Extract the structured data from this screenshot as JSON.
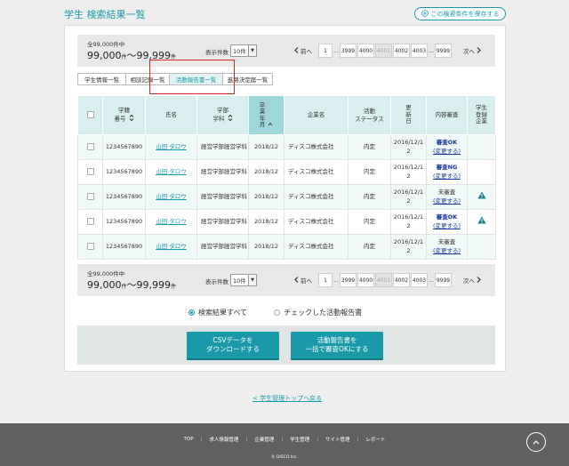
{
  "header": {
    "title": "学生 検索結果一覧",
    "save_button": "この検索条件を保存する"
  },
  "pagination": {
    "total_small": "全99,000件中",
    "range_from": "99,000",
    "range_to": "99,999",
    "unit": "件",
    "per_page_label": "表示件数",
    "per_page_value": "10件",
    "prev_label": "前へ",
    "next_label": "次へ",
    "pages": [
      "1",
      "…",
      "3999",
      "4000",
      "4001",
      "4002",
      "4003",
      "…",
      "9999"
    ],
    "current_page": "4001"
  },
  "tabs": [
    "学生情報一覧",
    "相談記録一覧",
    "活動報告書一覧",
    "進路決定届一覧"
  ],
  "active_tab": "活動報告書一覧",
  "table": {
    "headers": {
      "student_no": "学籍\n番号",
      "name": "氏名",
      "faculty": "学部\n学科",
      "grad_year": "卒\n業\n年\n月",
      "company": "企業名",
      "status": "活動\nステータス",
      "updated": "更\n新\n日",
      "review": "内容審査",
      "registered": "学生\n登録\n企業"
    },
    "rows": [
      {
        "student_no": "1234567890",
        "name": "山田 タロウ",
        "faculty": "経営学部経営学科",
        "grad_year": "2018/12",
        "company": "ディスコ株式会社",
        "status": "内定",
        "updated": "2016/12/12",
        "review": "審査OK",
        "review_bold": true,
        "change": "(変更する)",
        "warning": false
      },
      {
        "student_no": "1234567890",
        "name": "山田 タロウ",
        "faculty": "経営学部経営学科",
        "grad_year": "2018/12",
        "company": "ディスコ株式会社",
        "status": "内定",
        "updated": "2016/12/12",
        "review": "審査NG",
        "review_bold": true,
        "change": "(変更する)",
        "warning": false
      },
      {
        "student_no": "1234567890",
        "name": "山田 タロウ",
        "faculty": "経営学部経営学科",
        "grad_year": "2018/12",
        "company": "ディスコ株式会社",
        "status": "内定",
        "updated": "2016/12/12",
        "review": "未審査",
        "review_bold": false,
        "change": "(変更する)",
        "warning": true
      },
      {
        "student_no": "1234567890",
        "name": "山田 タロウ",
        "faculty": "経営学部経営学科",
        "grad_year": "2018/12",
        "company": "ディスコ株式会社",
        "status": "内定",
        "updated": "2016/12/12",
        "review": "審査OK",
        "review_bold": true,
        "change": "(変更する)",
        "warning": true
      },
      {
        "student_no": "1234567890",
        "name": "山田 タロウ",
        "faculty": "経営学部経営学科",
        "grad_year": "2018/12",
        "company": "ディスコ株式会社",
        "status": "内定",
        "updated": "2016/12/12",
        "review": "未審査",
        "review_bold": false,
        "change": "(変更する)",
        "warning": false
      }
    ]
  },
  "radios": {
    "all": "検索結果すべて",
    "checked": "チェックした活動報告書",
    "selected": "all"
  },
  "actions": {
    "csv": "CSVデータを\nダウンロードする",
    "approve": "活動報告書を\n一括で審査OKにする"
  },
  "back_link": "< 学生管理トップへ戻る",
  "footer": {
    "nav": [
      "TOP",
      "求人情報管理",
      "企業管理",
      "学生管理",
      "サイト管理",
      "レポート"
    ],
    "copyright": "© DISCO Inc."
  },
  "colors": {
    "accent": "#1a9aa8",
    "footer": "#616161",
    "warning": "#1a7f8a"
  }
}
